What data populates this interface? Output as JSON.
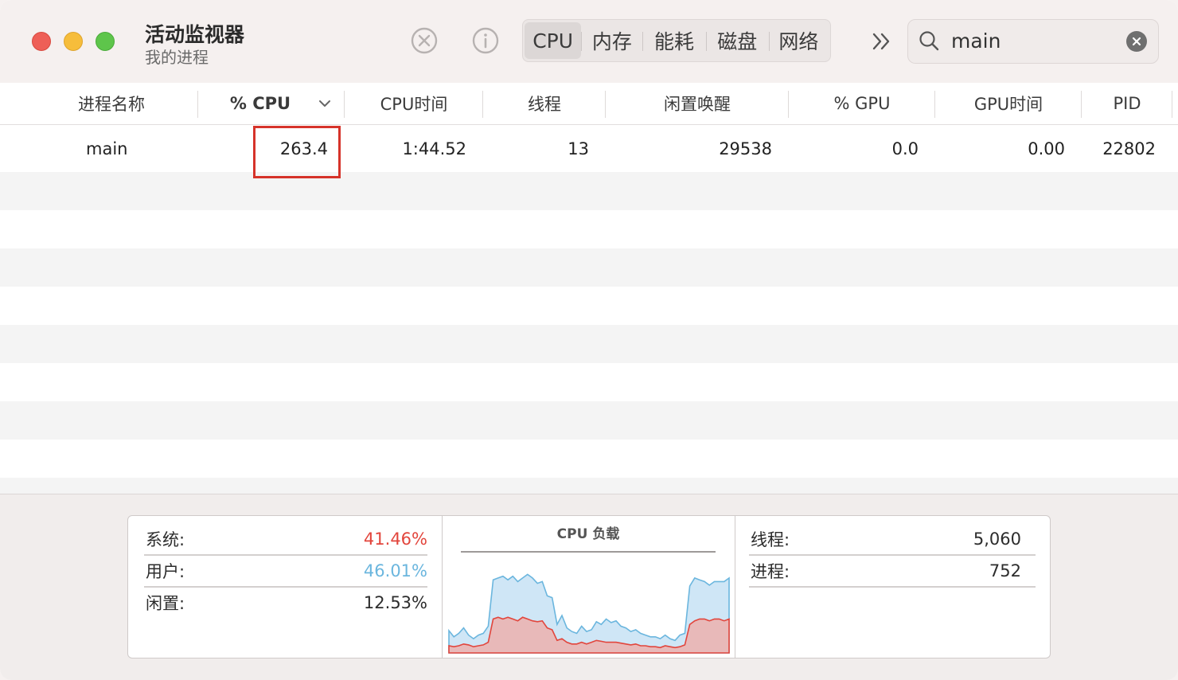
{
  "window": {
    "title": "活动监视器",
    "subtitle": "我的进程"
  },
  "toolbar": {
    "stop_icon": "x-circle-icon",
    "info_icon": "info-circle-icon",
    "tabs": [
      {
        "label": "CPU",
        "active": true
      },
      {
        "label": "内存",
        "active": false
      },
      {
        "label": "能耗",
        "active": false
      },
      {
        "label": "磁盘",
        "active": false
      },
      {
        "label": "网络",
        "active": false
      }
    ],
    "more_icon": "double-chevron-right-icon",
    "search": {
      "value": "main",
      "icon": "magnifier-icon",
      "clear_icon": "clear-x-icon"
    }
  },
  "table": {
    "columns": [
      "进程名称",
      "% CPU",
      "CPU时间",
      "线程",
      "闲置唤醒",
      "% GPU",
      "GPU时间",
      "PID"
    ],
    "sort_column": "% CPU",
    "sort_direction": "descending",
    "rows": [
      {
        "name": "main",
        "cpu": "263.4",
        "cpu_time": "1:44.52",
        "threads": "13",
        "idle_wake": "29538",
        "gpu": "0.0",
        "gpu_time": "0.00",
        "pid": "22802"
      }
    ]
  },
  "stats": {
    "system_label": "系统:",
    "system_value": "41.46%",
    "user_label": "用户:",
    "user_value": "46.01%",
    "idle_label": "闲置:",
    "idle_value": "12.53%",
    "chart_title": "CPU 负载",
    "threads_label": "线程:",
    "threads_value": "5,060",
    "processes_label": "进程:",
    "processes_value": "752"
  },
  "colors": {
    "system": "#e2453c",
    "user": "#6bb6de",
    "highlight": "#d6332a"
  },
  "chart_data": {
    "type": "area",
    "title": "CPU 负载",
    "series": [
      {
        "name": "用户",
        "values": [
          0.25,
          0.18,
          0.22,
          0.28,
          0.2,
          0.16,
          0.2,
          0.22,
          0.3,
          0.82,
          0.84,
          0.86,
          0.82,
          0.86,
          0.8,
          0.84,
          0.88,
          0.84,
          0.78,
          0.8,
          0.64,
          0.62,
          0.32,
          0.42,
          0.28,
          0.24,
          0.22,
          0.3,
          0.24,
          0.26,
          0.35,
          0.32,
          0.38,
          0.34,
          0.36,
          0.3,
          0.28,
          0.24,
          0.26,
          0.22,
          0.2,
          0.18,
          0.18,
          0.16,
          0.2,
          0.16,
          0.14,
          0.2,
          0.22,
          0.75,
          0.84,
          0.82,
          0.8,
          0.76,
          0.8,
          0.8,
          0.8,
          0.84
        ]
      },
      {
        "name": "系统",
        "values": [
          0.08,
          0.07,
          0.08,
          0.1,
          0.09,
          0.07,
          0.08,
          0.09,
          0.12,
          0.38,
          0.4,
          0.38,
          0.4,
          0.38,
          0.36,
          0.4,
          0.38,
          0.36,
          0.35,
          0.36,
          0.28,
          0.26,
          0.14,
          0.16,
          0.12,
          0.1,
          0.1,
          0.12,
          0.1,
          0.12,
          0.14,
          0.13,
          0.12,
          0.12,
          0.12,
          0.11,
          0.1,
          0.09,
          0.1,
          0.08,
          0.08,
          0.07,
          0.07,
          0.06,
          0.08,
          0.07,
          0.06,
          0.07,
          0.09,
          0.32,
          0.36,
          0.38,
          0.38,
          0.36,
          0.38,
          0.38,
          0.36,
          0.38
        ]
      }
    ],
    "ylim": [
      0,
      1
    ],
    "legend": "none",
    "grid": false
  }
}
